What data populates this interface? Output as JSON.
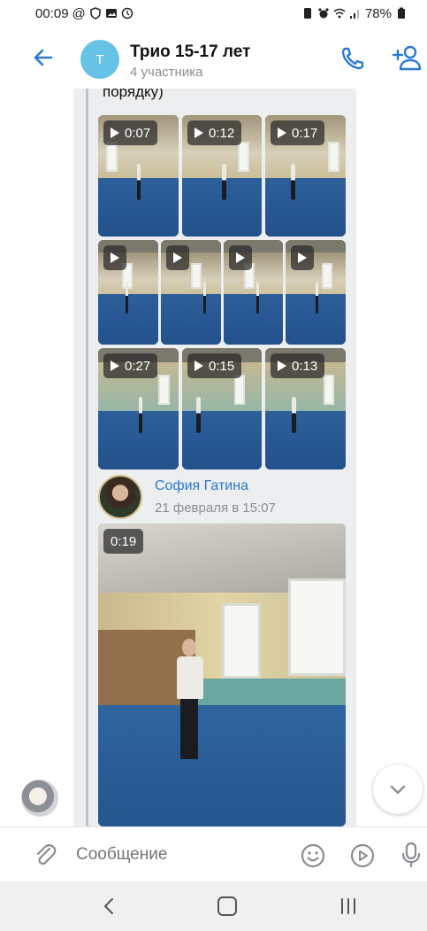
{
  "status_bar": {
    "time": "00:09",
    "battery": "78%"
  },
  "header": {
    "back_icon": "arrow-left-icon",
    "avatar_letter": "Т",
    "title": "Трио 15-17 лет",
    "subtitle": "4 участника",
    "call_icon": "phone-icon",
    "add_user_icon": "add-user-icon",
    "accent_color": "#2a7ad3"
  },
  "message": {
    "cut_text": "порядку)",
    "videos_row1": [
      {
        "duration": "0:07"
      },
      {
        "duration": "0:12"
      },
      {
        "duration": "0:17"
      }
    ],
    "videos_row2": [
      {
        "duration": ""
      },
      {
        "duration": ""
      },
      {
        "duration": ""
      },
      {
        "duration": ""
      }
    ],
    "videos_row3": [
      {
        "duration": "0:27"
      },
      {
        "duration": "0:15"
      },
      {
        "duration": "0:13"
      }
    ]
  },
  "next_message": {
    "author": "София Гатина",
    "date": "21 февраля в 15:07",
    "video_duration": "0:19"
  },
  "composer": {
    "placeholder": "Сообщение",
    "attach_icon": "paperclip-icon",
    "emoji_icon": "smile-icon",
    "video_icon": "play-circle-icon",
    "mic_icon": "microphone-icon"
  },
  "nav": {
    "back_icon": "nav-back-icon",
    "home_icon": "nav-home-icon",
    "recent_icon": "nav-recent-icon"
  }
}
